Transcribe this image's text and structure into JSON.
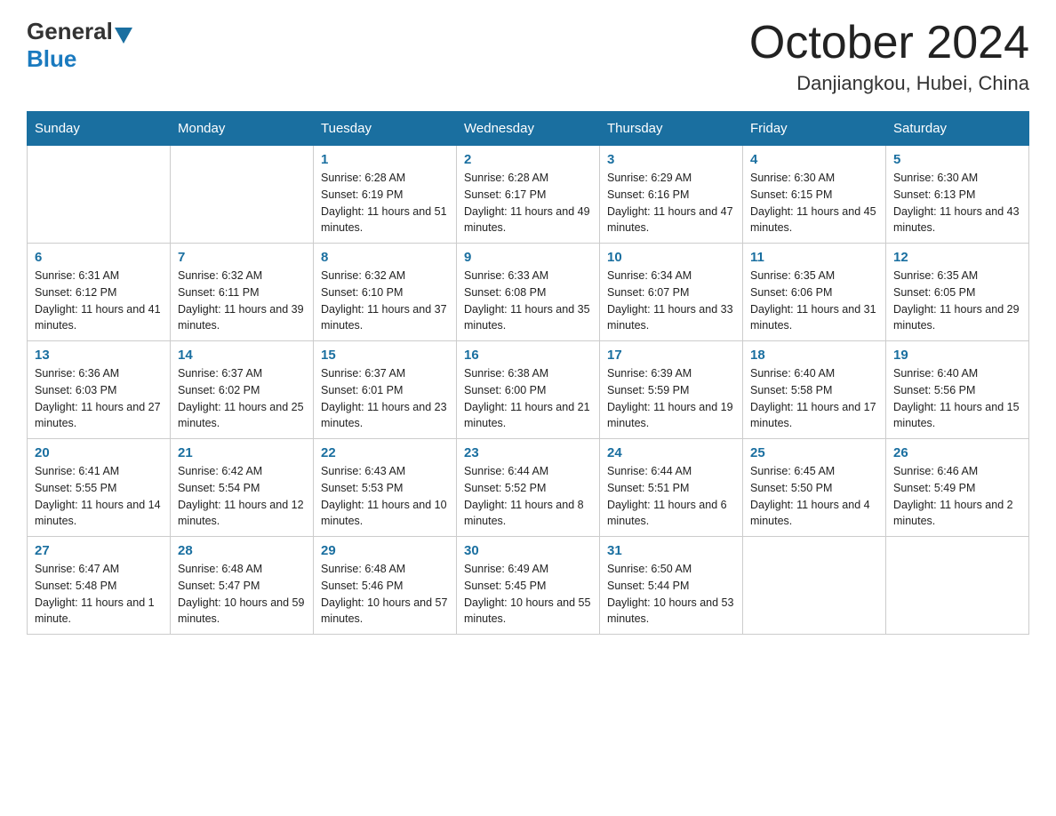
{
  "logo": {
    "general": "General",
    "blue": "Blue"
  },
  "title": "October 2024",
  "location": "Danjiangkou, Hubei, China",
  "days_of_week": [
    "Sunday",
    "Monday",
    "Tuesday",
    "Wednesday",
    "Thursday",
    "Friday",
    "Saturday"
  ],
  "weeks": [
    [
      null,
      null,
      {
        "day": 1,
        "sunrise": "6:28 AM",
        "sunset": "6:19 PM",
        "daylight": "11 hours and 51 minutes."
      },
      {
        "day": 2,
        "sunrise": "6:28 AM",
        "sunset": "6:17 PM",
        "daylight": "11 hours and 49 minutes."
      },
      {
        "day": 3,
        "sunrise": "6:29 AM",
        "sunset": "6:16 PM",
        "daylight": "11 hours and 47 minutes."
      },
      {
        "day": 4,
        "sunrise": "6:30 AM",
        "sunset": "6:15 PM",
        "daylight": "11 hours and 45 minutes."
      },
      {
        "day": 5,
        "sunrise": "6:30 AM",
        "sunset": "6:13 PM",
        "daylight": "11 hours and 43 minutes."
      }
    ],
    [
      {
        "day": 6,
        "sunrise": "6:31 AM",
        "sunset": "6:12 PM",
        "daylight": "11 hours and 41 minutes."
      },
      {
        "day": 7,
        "sunrise": "6:32 AM",
        "sunset": "6:11 PM",
        "daylight": "11 hours and 39 minutes."
      },
      {
        "day": 8,
        "sunrise": "6:32 AM",
        "sunset": "6:10 PM",
        "daylight": "11 hours and 37 minutes."
      },
      {
        "day": 9,
        "sunrise": "6:33 AM",
        "sunset": "6:08 PM",
        "daylight": "11 hours and 35 minutes."
      },
      {
        "day": 10,
        "sunrise": "6:34 AM",
        "sunset": "6:07 PM",
        "daylight": "11 hours and 33 minutes."
      },
      {
        "day": 11,
        "sunrise": "6:35 AM",
        "sunset": "6:06 PM",
        "daylight": "11 hours and 31 minutes."
      },
      {
        "day": 12,
        "sunrise": "6:35 AM",
        "sunset": "6:05 PM",
        "daylight": "11 hours and 29 minutes."
      }
    ],
    [
      {
        "day": 13,
        "sunrise": "6:36 AM",
        "sunset": "6:03 PM",
        "daylight": "11 hours and 27 minutes."
      },
      {
        "day": 14,
        "sunrise": "6:37 AM",
        "sunset": "6:02 PM",
        "daylight": "11 hours and 25 minutes."
      },
      {
        "day": 15,
        "sunrise": "6:37 AM",
        "sunset": "6:01 PM",
        "daylight": "11 hours and 23 minutes."
      },
      {
        "day": 16,
        "sunrise": "6:38 AM",
        "sunset": "6:00 PM",
        "daylight": "11 hours and 21 minutes."
      },
      {
        "day": 17,
        "sunrise": "6:39 AM",
        "sunset": "5:59 PM",
        "daylight": "11 hours and 19 minutes."
      },
      {
        "day": 18,
        "sunrise": "6:40 AM",
        "sunset": "5:58 PM",
        "daylight": "11 hours and 17 minutes."
      },
      {
        "day": 19,
        "sunrise": "6:40 AM",
        "sunset": "5:56 PM",
        "daylight": "11 hours and 15 minutes."
      }
    ],
    [
      {
        "day": 20,
        "sunrise": "6:41 AM",
        "sunset": "5:55 PM",
        "daylight": "11 hours and 14 minutes."
      },
      {
        "day": 21,
        "sunrise": "6:42 AM",
        "sunset": "5:54 PM",
        "daylight": "11 hours and 12 minutes."
      },
      {
        "day": 22,
        "sunrise": "6:43 AM",
        "sunset": "5:53 PM",
        "daylight": "11 hours and 10 minutes."
      },
      {
        "day": 23,
        "sunrise": "6:44 AM",
        "sunset": "5:52 PM",
        "daylight": "11 hours and 8 minutes."
      },
      {
        "day": 24,
        "sunrise": "6:44 AM",
        "sunset": "5:51 PM",
        "daylight": "11 hours and 6 minutes."
      },
      {
        "day": 25,
        "sunrise": "6:45 AM",
        "sunset": "5:50 PM",
        "daylight": "11 hours and 4 minutes."
      },
      {
        "day": 26,
        "sunrise": "6:46 AM",
        "sunset": "5:49 PM",
        "daylight": "11 hours and 2 minutes."
      }
    ],
    [
      {
        "day": 27,
        "sunrise": "6:47 AM",
        "sunset": "5:48 PM",
        "daylight": "11 hours and 1 minute."
      },
      {
        "day": 28,
        "sunrise": "6:48 AM",
        "sunset": "5:47 PM",
        "daylight": "10 hours and 59 minutes."
      },
      {
        "day": 29,
        "sunrise": "6:48 AM",
        "sunset": "5:46 PM",
        "daylight": "10 hours and 57 minutes."
      },
      {
        "day": 30,
        "sunrise": "6:49 AM",
        "sunset": "5:45 PM",
        "daylight": "10 hours and 55 minutes."
      },
      {
        "day": 31,
        "sunrise": "6:50 AM",
        "sunset": "5:44 PM",
        "daylight": "10 hours and 53 minutes."
      },
      null,
      null
    ]
  ]
}
